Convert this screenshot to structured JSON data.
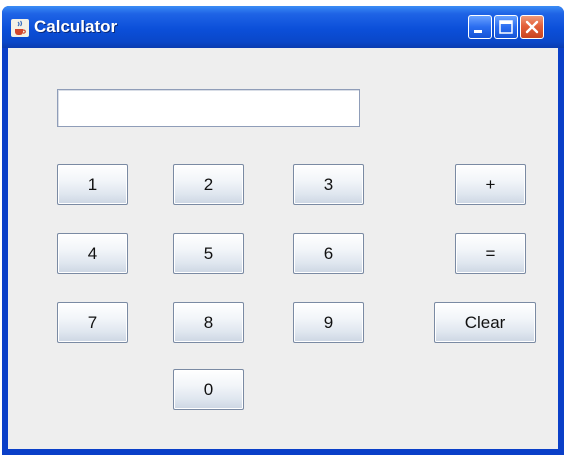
{
  "window": {
    "title": "Calculator",
    "app_icon": "java-cup-icon",
    "controls": {
      "minimize_icon": "minimize-icon",
      "maximize_icon": "maximize-icon",
      "close_icon": "close-icon"
    }
  },
  "display": {
    "value": ""
  },
  "keys": {
    "one": "1",
    "two": "2",
    "three": "3",
    "four": "4",
    "five": "5",
    "six": "6",
    "seven": "7",
    "eight": "8",
    "nine": "9",
    "zero": "0",
    "plus": "+",
    "equals": "=",
    "clear": "Clear"
  },
  "colors": {
    "titlebar": "#0b4fd9",
    "close_button": "#e3603a",
    "content_background": "#eeeeee"
  }
}
